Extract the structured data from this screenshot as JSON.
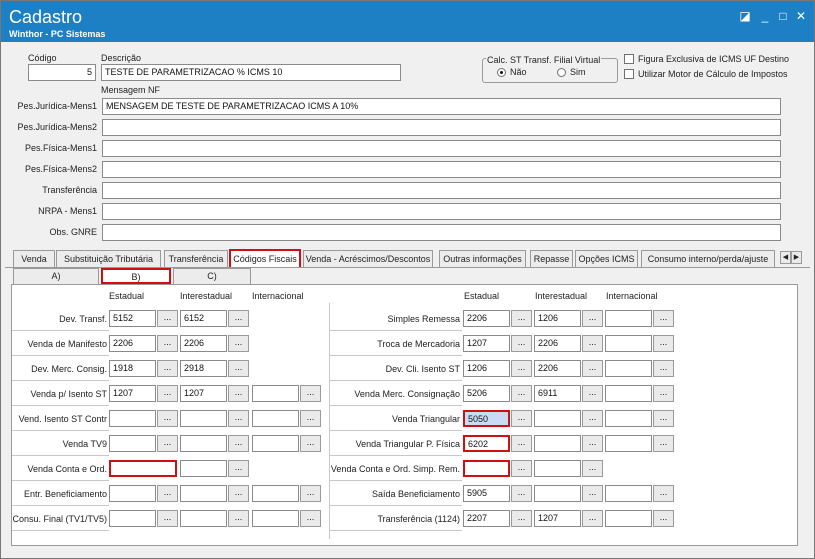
{
  "window": {
    "title": "Cadastro",
    "subtitle": "Winthor - PC Sistemas"
  },
  "header": {
    "codigo_label": "Código",
    "codigo_value": "5",
    "descricao_label": "Descrição",
    "descricao_value": "TESTE DE PARAMETRIZACAO % ICMS 10",
    "calc_st_label": "Calc. ST Transf. Filial Virtual",
    "radio_nao": "Não",
    "radio_sim": "Sim",
    "chk_figura": "Figura Exclusiva de ICMS UF Destino",
    "chk_motor": "Utilizar Motor de Cálculo de Impostos",
    "mensagem_nf_label": "Mensagem NF"
  },
  "messages": [
    {
      "label": "Pes.Jurídica-Mens1",
      "value": "MENSAGEM DE TESTE DE PARAMETRIZACAO ICMS A 10%"
    },
    {
      "label": "Pes.Jurídica-Mens2",
      "value": ""
    },
    {
      "label": "Pes.Física-Mens1",
      "value": ""
    },
    {
      "label": "Pes.Física-Mens2",
      "value": ""
    },
    {
      "label": "Transferência",
      "value": ""
    },
    {
      "label": "NRPA - Mens1",
      "value": ""
    },
    {
      "label": "Obs. GNRE",
      "value": ""
    }
  ],
  "tabs": [
    "Venda",
    "Substituição Tributária",
    "Transferência",
    "Códigos Fiscais",
    "Venda - Acréscimos/Descontos",
    "Outras informações",
    "Repasse",
    "Opções ICMS",
    "Consumo interno/perda/ajuste"
  ],
  "subtabs": [
    "A)",
    "B)",
    "C)"
  ],
  "columns": {
    "estadual": "Estadual",
    "interestadual": "Interestadual",
    "internacional": "Internacional"
  },
  "button_label": "...",
  "left_rows": [
    {
      "label": "Dev. Transf.",
      "e": "5152",
      "i": "6152"
    },
    {
      "label": "Venda de Manifesto",
      "e": "2206",
      "i": "2206"
    },
    {
      "label": "Dev. Merc. Consig.",
      "e": "1918",
      "i": "2918"
    },
    {
      "label": "Venda p/ Isento ST",
      "e": "1207",
      "i": "1207",
      "n": ""
    },
    {
      "label": "Vend. Isento ST Contr",
      "e": "",
      "i": "",
      "n": ""
    },
    {
      "label": "Venda TV9",
      "e": "",
      "i": "",
      "n": ""
    },
    {
      "label": "Venda Conta e Ord.",
      "e": "",
      "i": ""
    },
    {
      "label": "Entr. Beneficiamento",
      "e": "",
      "i": "",
      "n": ""
    },
    {
      "label": "Consu. Final (TV1/TV5)",
      "e": "",
      "i": "",
      "n": ""
    }
  ],
  "right_rows": [
    {
      "label": "Simples Remessa",
      "e": "2206",
      "i": "1206",
      "n": ""
    },
    {
      "label": "Troca de Mercadoria",
      "e": "1207",
      "i": "2206",
      "n": ""
    },
    {
      "label": "Dev. Cli. Isento ST",
      "e": "1206",
      "i": "2206",
      "n": ""
    },
    {
      "label": "Venda Merc. Consignação",
      "e": "5206",
      "i": "6911",
      "n": ""
    },
    {
      "label": "Venda Triangular",
      "e": "5050",
      "i": "",
      "n": ""
    },
    {
      "label": "Venda Triangular P. Física",
      "e": "6202",
      "i": "",
      "n": ""
    },
    {
      "label": "Venda Conta e Ord. Simp. Rem.",
      "e": "",
      "i": ""
    },
    {
      "label": "Saída Beneficiamento",
      "e": "5905",
      "i": "",
      "n": ""
    },
    {
      "label": "Transferência (1124)",
      "e": "2207",
      "i": "1207",
      "n": ""
    }
  ]
}
